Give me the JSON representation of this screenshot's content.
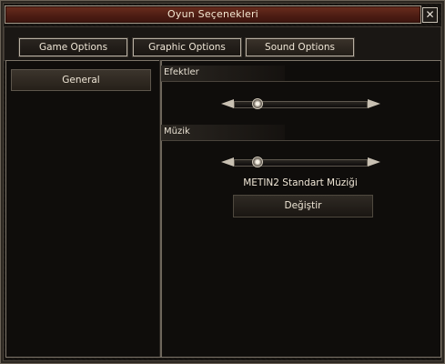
{
  "window": {
    "title": "Oyun Seçenekleri",
    "close_label": "✕"
  },
  "tabs": [
    {
      "label": "Game Options",
      "active": false
    },
    {
      "label": "Graphic Options",
      "active": false
    },
    {
      "label": "Sound Options",
      "active": true
    }
  ],
  "sidebar": {
    "items": [
      {
        "label": "General",
        "selected": true
      }
    ]
  },
  "sections": {
    "effects": {
      "label": "Efektler",
      "level": 0.15
    },
    "music": {
      "label": "Müzik",
      "level": 0.15,
      "current_track": "METIN2 Standart Müziği",
      "change_label": "Değiştir"
    }
  }
}
